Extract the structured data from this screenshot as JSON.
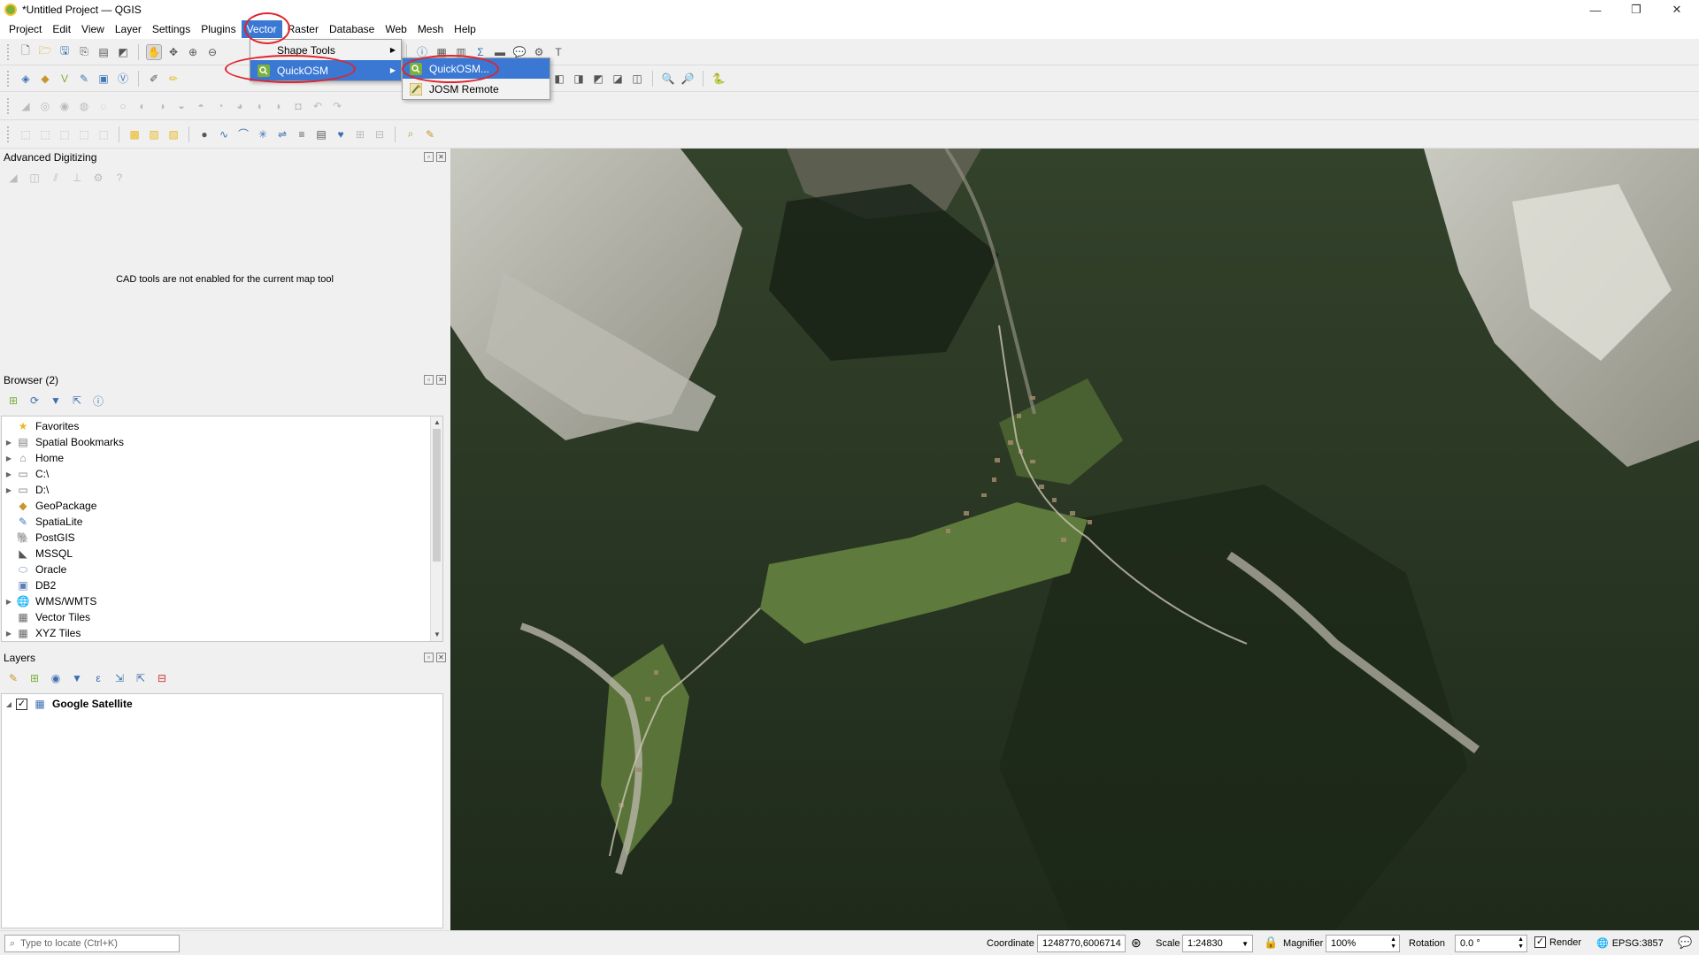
{
  "window": {
    "title": "*Untitled Project — QGIS",
    "controls": [
      "—",
      "❐",
      "✕"
    ]
  },
  "menubar": {
    "items": [
      {
        "label": "Project",
        "active": false
      },
      {
        "label": "Edit",
        "active": false
      },
      {
        "label": "View",
        "active": false
      },
      {
        "label": "Layer",
        "active": false
      },
      {
        "label": "Settings",
        "active": false
      },
      {
        "label": "Plugins",
        "active": false
      },
      {
        "label": "Vector",
        "active": true
      },
      {
        "label": "Raster",
        "active": false
      },
      {
        "label": "Database",
        "active": false
      },
      {
        "label": "Web",
        "active": false
      },
      {
        "label": "Mesh",
        "active": false
      },
      {
        "label": "Help",
        "active": false
      }
    ]
  },
  "vector_menu": {
    "items": [
      {
        "label": "Shape Tools",
        "icon": "none",
        "has_submenu": true,
        "selected": false
      },
      {
        "label": "QuickOSM",
        "icon": "quickosm-icon",
        "has_submenu": true,
        "selected": true
      }
    ]
  },
  "quickosm_submenu": {
    "items": [
      {
        "label": "QuickOSM...",
        "icon": "quickosm-icon",
        "selected": true
      },
      {
        "label": "JOSM Remote",
        "icon": "josm-icon",
        "selected": false
      }
    ]
  },
  "advanced_digitizing": {
    "title": "Advanced Digitizing",
    "message": "CAD tools are not enabled for the current map tool"
  },
  "browser": {
    "title": "Browser (2)",
    "items": [
      {
        "label": "Favorites",
        "icon": "star-icon",
        "expandable": false,
        "color": "#e8b923"
      },
      {
        "label": "Spatial Bookmarks",
        "icon": "bookmark-icon",
        "expandable": true,
        "color": "#7a7a7a"
      },
      {
        "label": "Home",
        "icon": "home-folder-icon",
        "expandable": true,
        "color": "#7a7a7a"
      },
      {
        "label": "C:\\",
        "icon": "drive-icon",
        "expandable": true,
        "color": "#7a7a7a"
      },
      {
        "label": "D:\\",
        "icon": "drive-icon",
        "expandable": true,
        "color": "#7a7a7a"
      },
      {
        "label": "GeoPackage",
        "icon": "geopackage-icon",
        "expandable": false,
        "color": "#c8962e"
      },
      {
        "label": "SpatiaLite",
        "icon": "spatialite-icon",
        "expandable": false,
        "color": "#3e79b8"
      },
      {
        "label": "PostGIS",
        "icon": "postgis-icon",
        "expandable": false,
        "color": "#3d6a9c"
      },
      {
        "label": "MSSQL",
        "icon": "mssql-icon",
        "expandable": false,
        "color": "#555"
      },
      {
        "label": "Oracle",
        "icon": "oracle-icon",
        "expandable": false,
        "color": "#7a8fb5"
      },
      {
        "label": "DB2",
        "icon": "db2-icon",
        "expandable": false,
        "color": "#5d7fb5"
      },
      {
        "label": "WMS/WMTS",
        "icon": "wms-icon",
        "expandable": true,
        "color": "#4a7bb8"
      },
      {
        "label": "Vector Tiles",
        "icon": "vector-tiles-icon",
        "expandable": false,
        "color": "#666"
      },
      {
        "label": "XYZ Tiles",
        "icon": "xyz-tiles-icon",
        "expandable": true,
        "color": "#666"
      }
    ]
  },
  "layers": {
    "title": "Layers",
    "items": [
      {
        "label": "Google Satellite",
        "checked": true,
        "icon": "raster-layer-icon"
      }
    ]
  },
  "statusbar": {
    "locator_placeholder": "Type to locate (Ctrl+K)",
    "coordinate_label": "Coordinate",
    "coordinate_value": "1248770,6006714",
    "scale_label": "Scale",
    "scale_value": "1:24830",
    "magnifier_label": "Magnifier",
    "magnifier_value": "100%",
    "rotation_label": "Rotation",
    "rotation_value": "0.0 °",
    "render_label": "Render",
    "render_checked": true,
    "crs_label": "EPSG:3857"
  },
  "colors": {
    "menu_highlight": "#3a78d4",
    "annotation_red": "#e0242b",
    "map_forest": "#2e3a27",
    "map_rock": "#c9c8c1",
    "map_meadow": "#5e7a3c"
  }
}
